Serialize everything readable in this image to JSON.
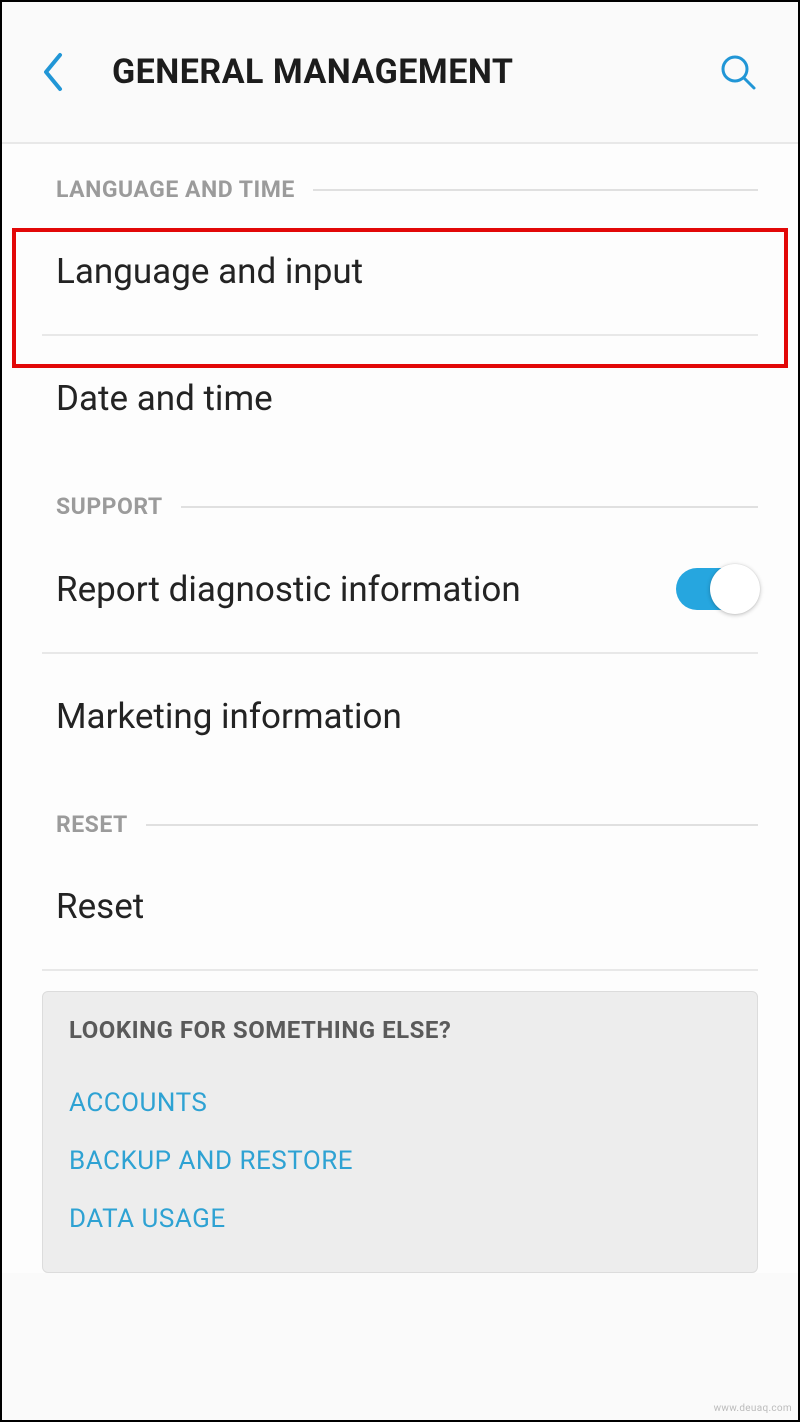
{
  "header": {
    "title": "GENERAL MANAGEMENT"
  },
  "sections": {
    "language_time": {
      "header": "LANGUAGE AND TIME",
      "items": {
        "language_input": "Language and input",
        "date_time": "Date and time"
      }
    },
    "support": {
      "header": "SUPPORT",
      "items": {
        "report_diag": "Report diagnostic information",
        "marketing": "Marketing information"
      }
    },
    "reset": {
      "header": "RESET",
      "items": {
        "reset": "Reset"
      }
    }
  },
  "card": {
    "title": "LOOKING FOR SOMETHING ELSE?",
    "links": {
      "accounts": "ACCOUNTS",
      "backup": "BACKUP AND RESTORE",
      "data_usage": "DATA USAGE"
    }
  },
  "toggles": {
    "report_diag": true
  },
  "watermark": "www.deuaq.com"
}
